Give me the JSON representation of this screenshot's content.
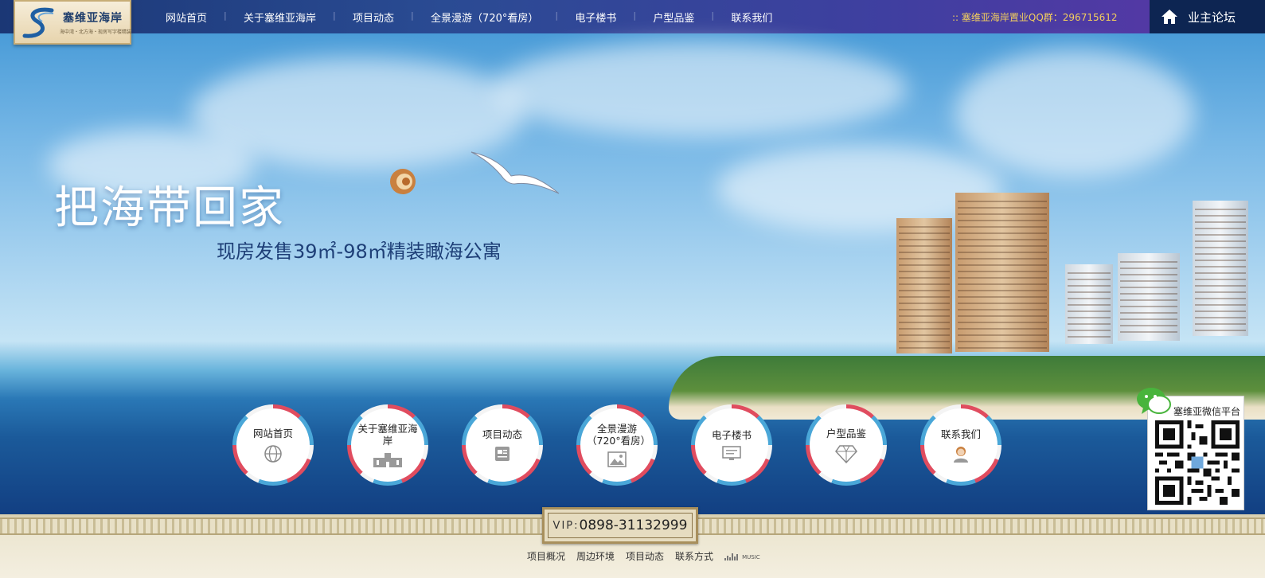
{
  "header": {
    "logo": {
      "name": "塞维亚海岸",
      "tagline": "海中湾・北方海・现房写字楼精装"
    },
    "nav": [
      {
        "label": "网站首页"
      },
      {
        "label": "关于塞维亚海岸"
      },
      {
        "label": "项目动态"
      },
      {
        "label": "全景漫游（720°看房）"
      },
      {
        "label": "电子楼书"
      },
      {
        "label": "户型品鉴"
      },
      {
        "label": "联系我们"
      }
    ],
    "qq_group": ":: 塞维亚海岸置业QQ群：296715612",
    "forum": {
      "label": "业主论坛",
      "icon": "home-icon"
    }
  },
  "hero": {
    "slogan": "把海带回家",
    "subtitle": "现房发售39㎡-98㎡精装瞰海公寓",
    "colors": {
      "sky": "#76b7e6",
      "sea": "#123f82"
    }
  },
  "circle_nav": [
    {
      "label": "网站首页",
      "icon": "globe-icon"
    },
    {
      "label": "关于塞维亚海岸",
      "icon": "building-icon"
    },
    {
      "label": "项目动态",
      "icon": "news-icon"
    },
    {
      "label": "全景漫游（720°看房）",
      "icon": "image-icon"
    },
    {
      "label": "电子楼书",
      "icon": "monitor-icon"
    },
    {
      "label": "户型品鉴",
      "icon": "diamond-icon"
    },
    {
      "label": "联系我们",
      "icon": "contact-icon"
    }
  ],
  "footer": {
    "vip_label": "VIP:",
    "vip_phone": "0898-31132999",
    "links": [
      {
        "label": "项目概况"
      },
      {
        "label": "周边环境"
      },
      {
        "label": "项目动态"
      },
      {
        "label": "联系方式"
      }
    ],
    "music_label": "MUSIC"
  },
  "wechat": {
    "title": "塞维亚微信平台",
    "icon": "wechat-icon"
  }
}
